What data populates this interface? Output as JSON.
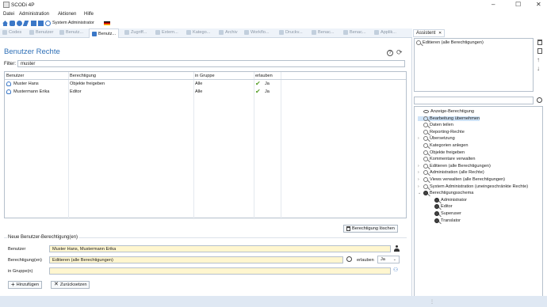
{
  "window": {
    "title": "SCODi 4P",
    "controls": [
      "–",
      "☐",
      "✕"
    ]
  },
  "menu": [
    "Datei",
    "Administration",
    "Aktionen",
    "Hilfe"
  ],
  "toolbar": {
    "user_label": "System Administrator"
  },
  "tabs": [
    {
      "label": "Codes",
      "active": false
    },
    {
      "label": "Benutzer",
      "active": false
    },
    {
      "label": "Benutz...",
      "active": false
    },
    {
      "label": "Benutz...",
      "active": true
    },
    {
      "label": "Zugriff...",
      "active": false
    },
    {
      "label": "Extern...",
      "active": false
    },
    {
      "label": "Katego...",
      "active": false
    },
    {
      "label": "Archiv",
      "active": false
    },
    {
      "label": "Workflo...",
      "active": false
    },
    {
      "label": "Druckv...",
      "active": false
    },
    {
      "label": "Benac...",
      "active": false
    },
    {
      "label": "Benac...",
      "active": false
    },
    {
      "label": "Applik...",
      "active": false
    }
  ],
  "page": {
    "title": "Benutzer Rechte",
    "filter_label": "Filter:",
    "filter_value": "muster"
  },
  "grid": {
    "columns": [
      "Benutzer",
      "Berechtigung",
      "in Gruppe",
      "erlauben"
    ],
    "rows": [
      {
        "user": "Muster Hans",
        "permission": "Objekte freigeben",
        "group": "Alle",
        "allow": "Ja"
      },
      {
        "user": "Mustermann Erika",
        "permission": "Editor",
        "group": "Alle",
        "allow": "Ja"
      }
    ]
  },
  "delete_button": "Berechtigung löschen",
  "new_section": {
    "legend": "Neue Benutzer-Berechtigung(en)",
    "user_label": "Benutzer",
    "user_value": "Muster Hans, Mustermann Erika",
    "perm_label": "Berechtigung(en)",
    "perm_value": "Editieren (alle Berechtigungen)",
    "allow_label": "erlauben",
    "allow_value": "Ja",
    "group_label": "in Gruppe(n)",
    "group_value": "",
    "add_button": "Hinzufügen",
    "reset_button": "Zurücksetzen"
  },
  "assistant": {
    "tab_label": "Assistent",
    "selected_item": "Editieren (alle Berechtigungen)",
    "search_value": "",
    "tree": [
      {
        "label": "Anzeige-Berechtigung",
        "level": 1,
        "expand": "",
        "icon": "eye",
        "selected": false
      },
      {
        "label": "Bearbeitung übernehmen",
        "level": 1,
        "expand": "",
        "icon": "key",
        "selected": true
      },
      {
        "label": "Daten teilen",
        "level": 1,
        "expand": "",
        "icon": "key",
        "selected": false
      },
      {
        "label": "Reporting-Rechte",
        "level": 1,
        "expand": "",
        "icon": "key",
        "selected": false
      },
      {
        "label": "Übersetzung",
        "level": 1,
        "expand": "›",
        "icon": "key",
        "selected": false
      },
      {
        "label": "Kategorien anlegen",
        "level": 1,
        "expand": "",
        "icon": "key",
        "selected": false
      },
      {
        "label": "Objekte freigeben",
        "level": 1,
        "expand": "",
        "icon": "key",
        "selected": false
      },
      {
        "label": "Kommentare verwalten",
        "level": 1,
        "expand": "",
        "icon": "key",
        "selected": false
      },
      {
        "label": "Editieren (alle Berechtigungen)",
        "level": 1,
        "expand": "›",
        "icon": "key",
        "selected": false
      },
      {
        "label": "Administration (alle Rechte)",
        "level": 1,
        "expand": "›",
        "icon": "key",
        "selected": false
      },
      {
        "label": "Views verwalten (alle Berechtigungen)",
        "level": 1,
        "expand": "›",
        "icon": "key",
        "selected": false
      },
      {
        "label": "System Administration (uneingeschränkte Rechte)",
        "level": 1,
        "expand": "›",
        "icon": "key",
        "selected": false
      },
      {
        "label": "Berechtigungsschema",
        "level": 1,
        "expand": "⌄",
        "icon": "key-dark",
        "selected": false
      },
      {
        "label": "Administrator",
        "level": 2,
        "expand": "",
        "icon": "key-dark",
        "selected": false
      },
      {
        "label": "Editor",
        "level": 2,
        "expand": "",
        "icon": "key-dark",
        "selected": false
      },
      {
        "label": "Superuser",
        "level": 2,
        "expand": "",
        "icon": "key-dark",
        "selected": false
      },
      {
        "label": "Translator",
        "level": 2,
        "expand": "",
        "icon": "key-dark",
        "selected": false
      }
    ]
  },
  "colors": {
    "accent": "#2e6fb6",
    "selection": "#cfe3f7",
    "status_bar": "#dfe8f3",
    "check": "#5aa02c"
  }
}
